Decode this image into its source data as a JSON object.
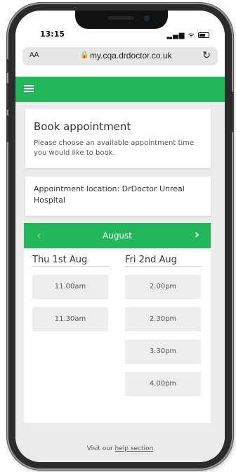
{
  "status_bar": {
    "time": "13:15",
    "signal": "▂▄▆",
    "wifi": "ᯤ"
  },
  "browser": {
    "text_size_label": "AA",
    "lock_icon": "lock-icon",
    "url": "my.cqa.drdoctor.co.uk",
    "reload_icon": "reload-icon"
  },
  "app_bar": {
    "menu_icon": "hamburger-menu-icon",
    "brand_color": "#22b75a"
  },
  "booking": {
    "title": "Book appointment",
    "description": "Please choose an available appointment time you would like to book."
  },
  "location": {
    "text": "Appointment location: DrDoctor Unreal Hospital"
  },
  "calendar": {
    "prev_arrow": "‹",
    "month": "August",
    "next_arrow": "›",
    "days": [
      {
        "label": "Thu 1st Aug",
        "slots": [
          "11.00am",
          "11.30am"
        ]
      },
      {
        "label": "Fri 2nd Aug",
        "slots": [
          "2.00pm",
          "2.30pm",
          "3.30pm",
          "4.00pm"
        ]
      }
    ]
  },
  "footer": {
    "prefix": "Visit our",
    "link": "help section"
  }
}
